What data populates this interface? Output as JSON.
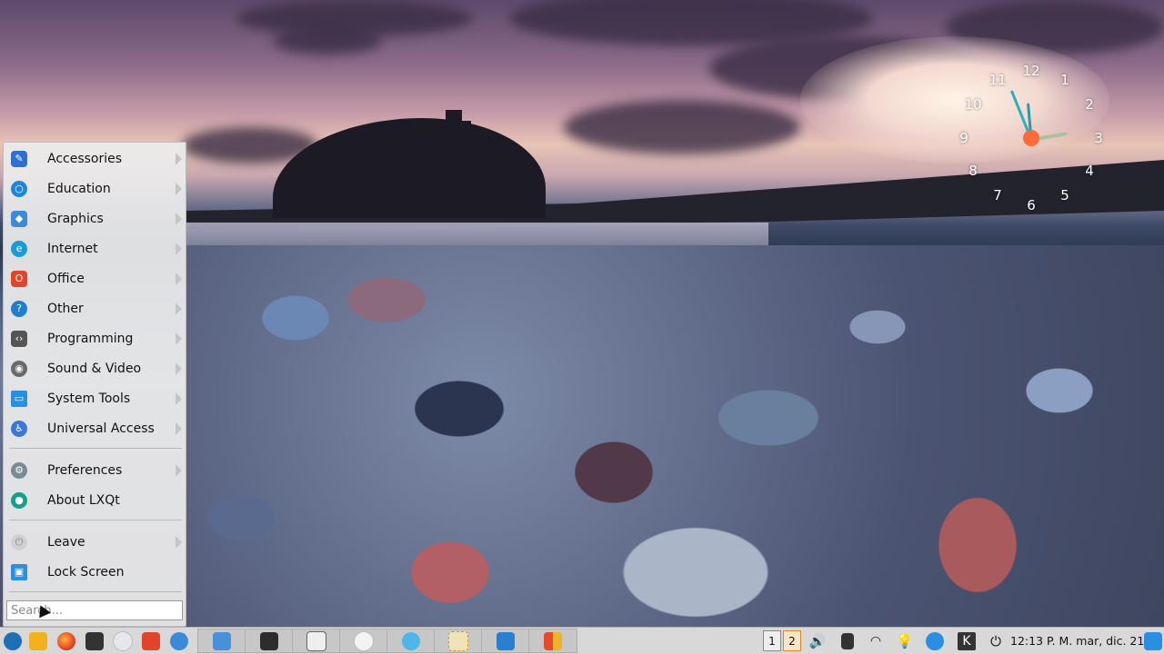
{
  "desktop": {
    "clock_widget": {
      "numbers": [
        "12",
        "1",
        "2",
        "3",
        "4",
        "5",
        "6",
        "7",
        "8",
        "9",
        "10",
        "11"
      ]
    }
  },
  "menu": {
    "items": [
      {
        "label": "Accessories",
        "icon": "accessories-icon",
        "color": "#2f6fd0",
        "submenu": true
      },
      {
        "label": "Education",
        "icon": "education-icon",
        "color": "#1e86d8",
        "submenu": true
      },
      {
        "label": "Graphics",
        "icon": "graphics-icon",
        "color": "#3a8ad8",
        "submenu": true
      },
      {
        "label": "Internet",
        "icon": "internet-icon",
        "color": "#1a9ad8",
        "submenu": true
      },
      {
        "label": "Office",
        "icon": "office-icon",
        "color": "#e0442a",
        "submenu": true
      },
      {
        "label": "Other",
        "icon": "other-icon",
        "color": "#1e7fcf",
        "submenu": true
      },
      {
        "label": "Programming",
        "icon": "programming-icon",
        "color": "#555555",
        "submenu": true
      },
      {
        "label": "Sound & Video",
        "icon": "sound-video-icon",
        "color": "#6a6a6a",
        "submenu": true
      },
      {
        "label": "System Tools",
        "icon": "system-tools-icon",
        "color": "#2a8fe0",
        "submenu": true
      },
      {
        "label": "Universal Access",
        "icon": "universal-access-icon",
        "color": "#3a78d8",
        "submenu": true
      }
    ],
    "preferences": {
      "label": "Preferences",
      "icon": "gear-icon",
      "submenu": true
    },
    "about": {
      "label": "About LXQt",
      "icon": "about-icon"
    },
    "leave": {
      "label": "Leave",
      "icon": "power-icon",
      "submenu": true
    },
    "lock": {
      "label": "Lock Screen",
      "icon": "lock-screen-icon"
    },
    "search_placeholder": "Search..."
  },
  "taskbar": {
    "quicklaunch": [
      "app-menu-icon",
      "file-manager-icon",
      "firefox-icon",
      "terminal-icon",
      "disk-icon",
      "office-icon",
      "gear-tool-icon"
    ],
    "tasks": [
      "folder-icon",
      "toolbox-icon",
      "penguin-icon",
      "circle-icon",
      "smile-icon",
      "clock-icon",
      "image-icon",
      "pdf-icon"
    ],
    "desktops": [
      "1",
      "2"
    ],
    "active_desktop": "2",
    "tray": [
      "volume-icon",
      "battery-icon",
      "wifi-icon",
      "bulb-icon",
      "chat-icon",
      "k-icon",
      "power-icon"
    ],
    "clock": "12:13 P. M. mar, dic. 21"
  }
}
